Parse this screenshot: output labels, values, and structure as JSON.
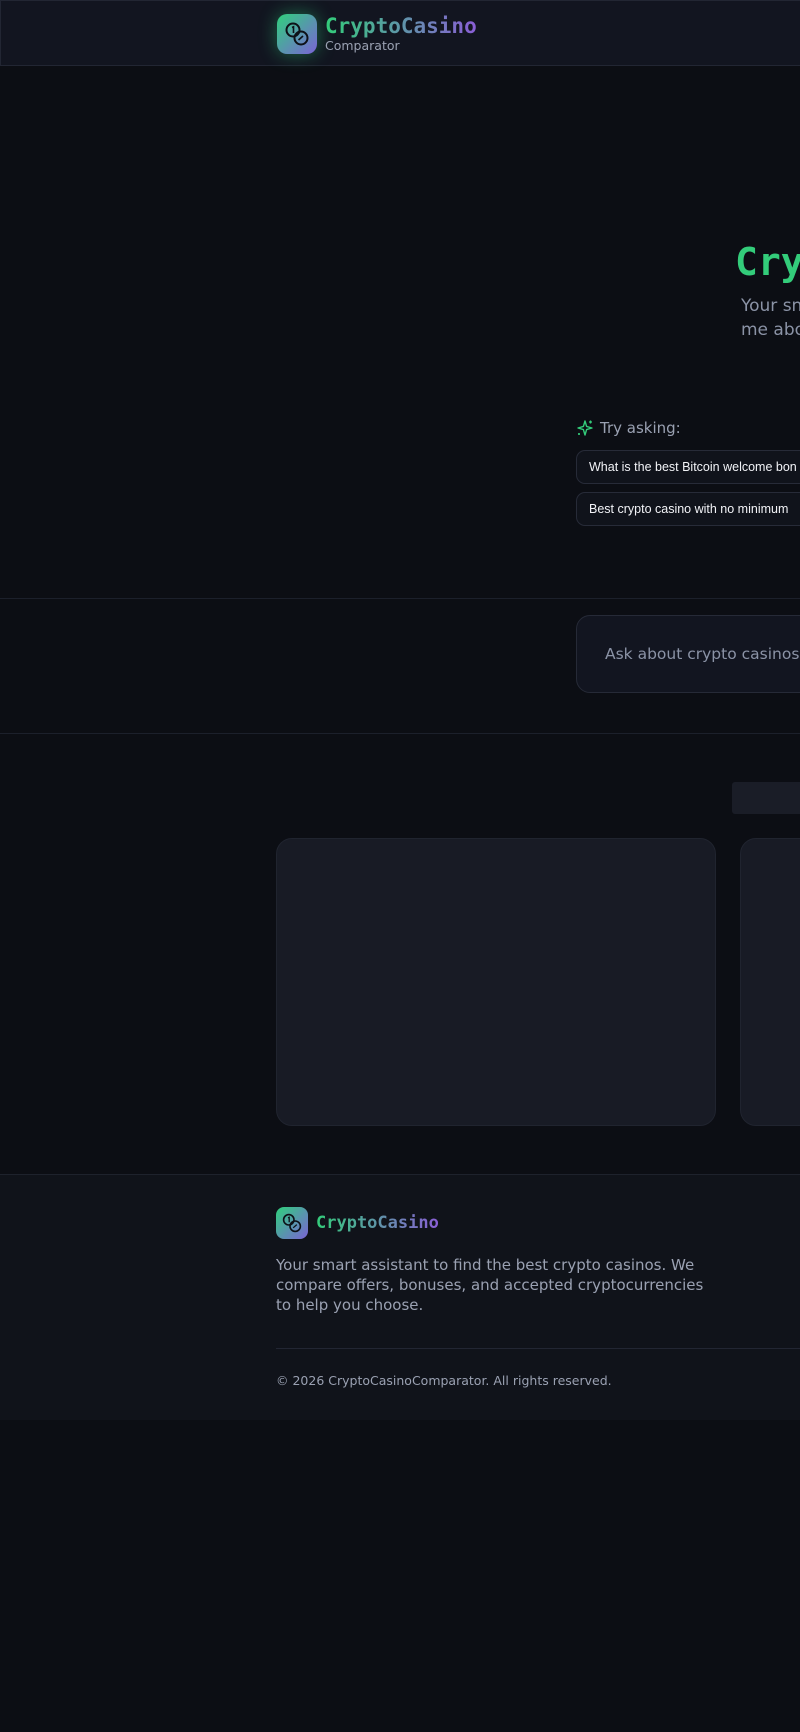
{
  "header": {
    "brand": "CryptoCasino",
    "subtitle": "Comparator"
  },
  "hero": {
    "title": "Cryp",
    "subtitle_line1": "Your sn",
    "subtitle_line2": "me abou"
  },
  "suggestions": {
    "label": "Try asking:",
    "items": [
      "What is the best Bitcoin welcome bon",
      "Best crypto casino with no minimum"
    ]
  },
  "chat": {
    "placeholder": "Ask about crypto casinos... E.g."
  },
  "footer": {
    "brand": "CryptoCasino",
    "description": "Your smart assistant to find the best crypto casinos. We compare offers, bonuses, and accepted cryptocurrencies to help you choose.",
    "copyright": "© 2026 CryptoCasinoComparator. All rights reserved."
  },
  "colors": {
    "accent_green": "#33cc7a",
    "accent_purple": "#8a5ed6",
    "background": "#0c0e14"
  }
}
